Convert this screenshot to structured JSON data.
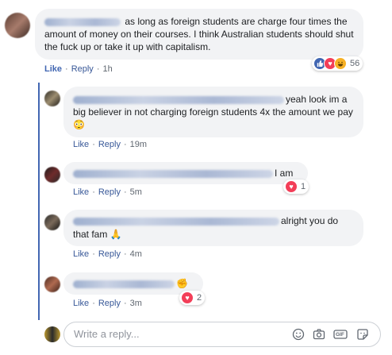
{
  "comments": [
    {
      "text": " as long as foreign students are charge four times the amount of money on their courses. I think Australian students should shut the fuck up or take it up with capitalism.",
      "actions": {
        "like": "Like",
        "reply": "Reply",
        "time": "1h"
      },
      "reaction_count": "56",
      "reactions": [
        "like",
        "love",
        "haha"
      ]
    }
  ],
  "replies": [
    {
      "text": "yeah look im a big believer in not charging foreign students 4x the amount we pay 😳",
      "actions": {
        "like": "Like",
        "reply": "Reply",
        "time": "19m"
      }
    },
    {
      "text": "I am",
      "actions": {
        "like": "Like",
        "reply": "Reply",
        "time": "5m"
      },
      "reaction_count": "1",
      "reactions": [
        "love"
      ]
    },
    {
      "text": "alright you do that fam 🙏",
      "actions": {
        "like": "Like",
        "reply": "Reply",
        "time": "4m"
      }
    },
    {
      "text": "✊",
      "actions": {
        "like": "Like",
        "reply": "Reply",
        "time": "3m"
      },
      "reaction_count": "2",
      "reactions": [
        "love"
      ]
    }
  ],
  "composer": {
    "placeholder": "Write a reply...",
    "tools": [
      "emoji-icon",
      "camera-icon",
      "gif-icon",
      "sticker-icon"
    ],
    "gif_label": "GIF"
  },
  "colors": {
    "link": "#385898",
    "like": "#4267b2",
    "love": "#f33e58",
    "haha": "#f7b125",
    "bubble": "#f2f3f5"
  }
}
